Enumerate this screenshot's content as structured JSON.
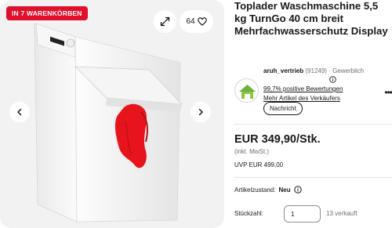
{
  "gallery": {
    "badge": "IN 7 WARENKÖRBEN",
    "watch_count": "64",
    "icons": {
      "expand": "expand-icon",
      "heart": "heart-icon",
      "prev": "chevron-left-icon",
      "next": "chevron-right-icon"
    }
  },
  "product": {
    "title": "Toplader Waschmaschine 5,5 kg TurnGo 40 cm breit Mehrfachwasserschutz Display"
  },
  "seller": {
    "name": "aruh_vertrieb",
    "feedback_count": "(91249)",
    "separator": "·",
    "type": "Gewerblich",
    "positive_rating": "99,7% positive Bewertungen",
    "more_items": "Mehr Artikel des Verkäufers",
    "message_button": "Nachricht",
    "more_options": "•••"
  },
  "pricing": {
    "price": "EUR 349,90/Stk.",
    "vat_note": "(inkl. MwSt.)",
    "uvp": "UVP EUR 499,00"
  },
  "condition": {
    "label": "Artikelzustand:",
    "value": "Neu"
  },
  "quantity": {
    "label": "Stückzahl:",
    "value": "1",
    "sold": "13 verkauft"
  },
  "colors": {
    "badge_red": "#e0102b",
    "gallery_bg": "#f2f2f2",
    "cloth_red": "#e8141c"
  }
}
